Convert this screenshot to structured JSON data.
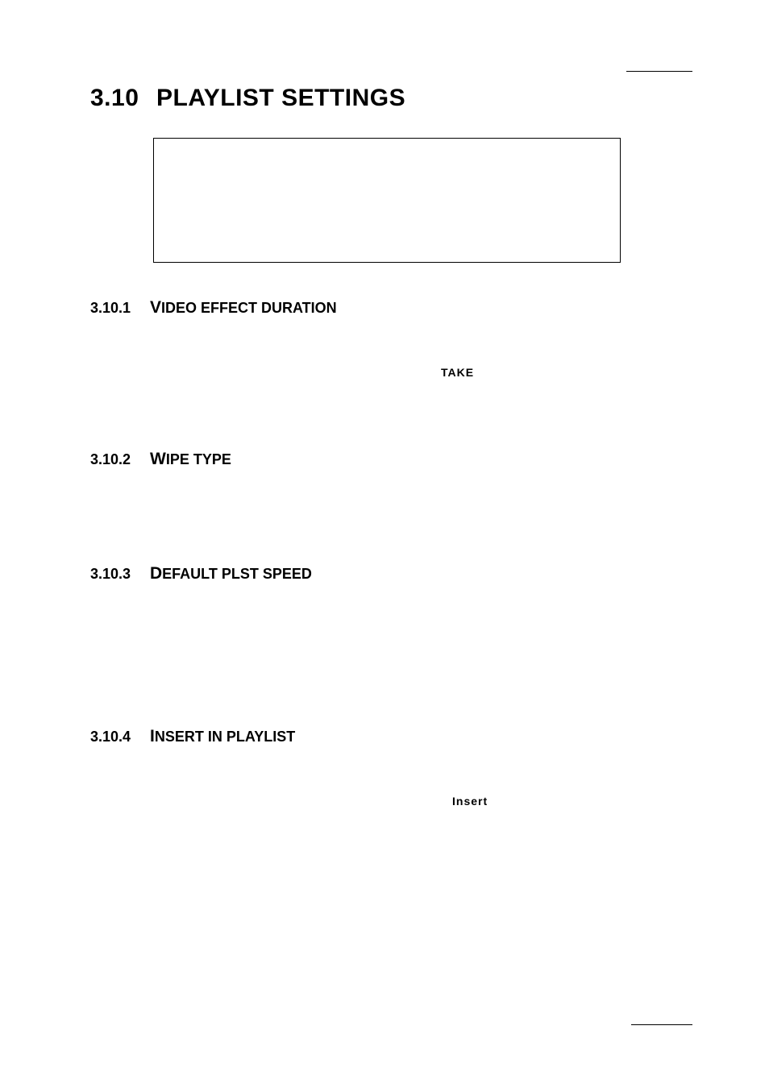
{
  "section": {
    "number": "3.10",
    "title": "PLAYLIST SETTINGS"
  },
  "subsections": [
    {
      "number": "3.10.1",
      "first_cap": "V",
      "rest": "IDEO EFFECT DURATION",
      "emph": "TAKE"
    },
    {
      "number": "3.10.2",
      "first_cap": "W",
      "rest": "IPE TYPE",
      "emph": ""
    },
    {
      "number": "3.10.3",
      "first_cap": "D",
      "rest": "EFAULT PLST SPEED",
      "emph": ""
    },
    {
      "number": "3.10.4",
      "first_cap": "I",
      "rest": "NSERT IN PLAYLIST",
      "emph": "Insert"
    }
  ]
}
